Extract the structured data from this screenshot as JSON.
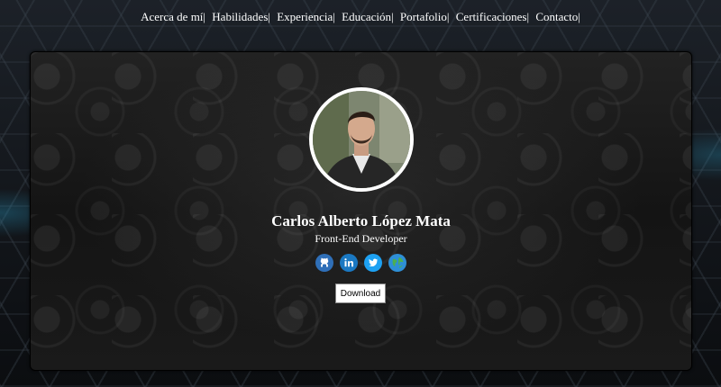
{
  "nav": {
    "items": [
      {
        "label": "Acerca de mí"
      },
      {
        "label": "Habilidades"
      },
      {
        "label": "Experiencia"
      },
      {
        "label": "Educación"
      },
      {
        "label": "Portafolio"
      },
      {
        "label": "Certificaciones"
      },
      {
        "label": "Contacto"
      }
    ],
    "separator": "|"
  },
  "profile": {
    "name": "Carlos Alberto López Mata",
    "role": "Front-End Developer",
    "photo_icon": "profile-photo"
  },
  "socials": [
    {
      "icon": "github-icon",
      "color": "#2f6fb8"
    },
    {
      "icon": "linkedin-icon",
      "color": "#1a78c2"
    },
    {
      "icon": "twitter-icon",
      "color": "#1da1f2"
    },
    {
      "icon": "globe-icon",
      "color": "#2e8fd6"
    }
  ],
  "download": {
    "label": "Download"
  },
  "colors": {
    "text": "#ffffff",
    "card_background": "#141414"
  }
}
